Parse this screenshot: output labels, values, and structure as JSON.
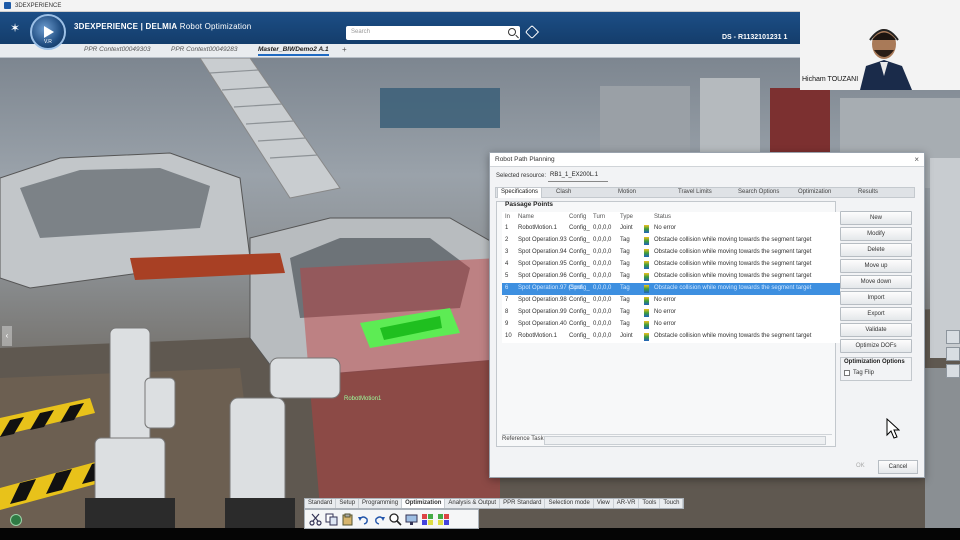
{
  "os_bar": {
    "title": "3DEXPERIENCE"
  },
  "header": {
    "brand": "3DEXPERIENCE | DELMIA",
    "app_name": "Robot Optimization",
    "search_placeholder": "Search",
    "compass_version": "V.R",
    "tenant": "DS - R1132101231 1"
  },
  "tabs": [
    {
      "label": "PPR Context00049303",
      "active": false
    },
    {
      "label": "PPR Context00049283",
      "active": false
    },
    {
      "label": "Master_BIWDemo2 A.1",
      "active": true
    }
  ],
  "tab_add": "+",
  "webcam": {
    "name": "Hicham TOUZANI"
  },
  "viewport": {
    "robot_label": "RobotMotion1"
  },
  "dialog": {
    "title": "Robot Path Planning",
    "close": "×",
    "selected_resource_label": "Selected resource:",
    "selected_resource_value": "RB1_1_EX200L.1",
    "tabs": [
      "Specifications",
      "Clash",
      "Motion",
      "Travel Limits",
      "Search Options",
      "Optimization",
      "Results"
    ],
    "active_tab": "Specifications",
    "passage_points": {
      "title": "Passage Points",
      "columns": {
        "idx": "In",
        "name": "Name",
        "config": "Config",
        "turn": "Turn",
        "type": "Type",
        "status": "Status"
      },
      "rows": [
        {
          "idx": "1",
          "name": "RobotMotion.1",
          "config": "Config_",
          "turn": "0,0,0,0",
          "type": "Joint",
          "status": "No error",
          "selected": false
        },
        {
          "idx": "2",
          "name": "Spot Operation.93",
          "config": "Config_",
          "turn": "0,0,0,0",
          "type": "Tag",
          "status": "Obstacle collision while moving towards the segment target",
          "selected": false
        },
        {
          "idx": "3",
          "name": "Spot Operation.94",
          "config": "Config_",
          "turn": "0,0,0,0",
          "type": "Tag",
          "status": "Obstacle collision while moving towards the segment target",
          "selected": false
        },
        {
          "idx": "4",
          "name": "Spot Operation.95",
          "config": "Config_",
          "turn": "0,0,0,0",
          "type": "Tag",
          "status": "Obstacle collision while moving towards the segment target",
          "selected": false
        },
        {
          "idx": "5",
          "name": "Spot Operation.96",
          "config": "Config_",
          "turn": "0,0,0,0",
          "type": "Tag",
          "status": "Obstacle collision while moving towards the segment target",
          "selected": false
        },
        {
          "idx": "6",
          "name": "Spot Operation.97 (Spot",
          "config": "Config_",
          "turn": "0,0,0,0",
          "type": "Tag",
          "status": "Obstacle collision while moving towards the segment target",
          "selected": true
        },
        {
          "idx": "7",
          "name": "Spot Operation.98",
          "config": "Config_",
          "turn": "0,0,0,0",
          "type": "Tag",
          "status": "No error",
          "selected": false
        },
        {
          "idx": "8",
          "name": "Spot Operation.99",
          "config": "Config_",
          "turn": "0,0,0,0",
          "type": "Tag",
          "status": "No error",
          "selected": false
        },
        {
          "idx": "9",
          "name": "Spot Operation.40",
          "config": "Config_",
          "turn": "0,0,0,0",
          "type": "Tag",
          "status": "No error",
          "selected": false
        },
        {
          "idx": "10",
          "name": "RobotMotion.1",
          "config": "Config_",
          "turn": "0,0,0,0",
          "type": "Joint",
          "status": "Obstacle collision while moving towards the segment target",
          "selected": false
        }
      ]
    },
    "reference_task_label": "Reference Task:",
    "buttons": [
      "New",
      "Modify",
      "Delete",
      "Move up",
      "Move down",
      "Import",
      "Export",
      "Validate",
      "Optimize DOFs"
    ],
    "optimization_options": {
      "title": "Optimization Options",
      "tag_flip": "Tag Flip"
    },
    "ok": "OK",
    "cancel": "Cancel"
  },
  "action_bar": {
    "tabs": [
      "Standard",
      "Setup",
      "Programming",
      "Optimization",
      "Analysis & Output",
      "PPR Standard",
      "Selection mode",
      "View",
      "AR-VR",
      "Tools",
      "Touch"
    ],
    "active": "Optimization",
    "icons": [
      "cut-icon",
      "copy-icon",
      "paste-icon",
      "undo-icon",
      "redo-icon",
      "zoom-icon",
      "screen-icon",
      "grid-icon",
      "grid2-icon"
    ]
  },
  "colors": {
    "accent": "#3d8fe0",
    "header": "#1c4e86"
  }
}
